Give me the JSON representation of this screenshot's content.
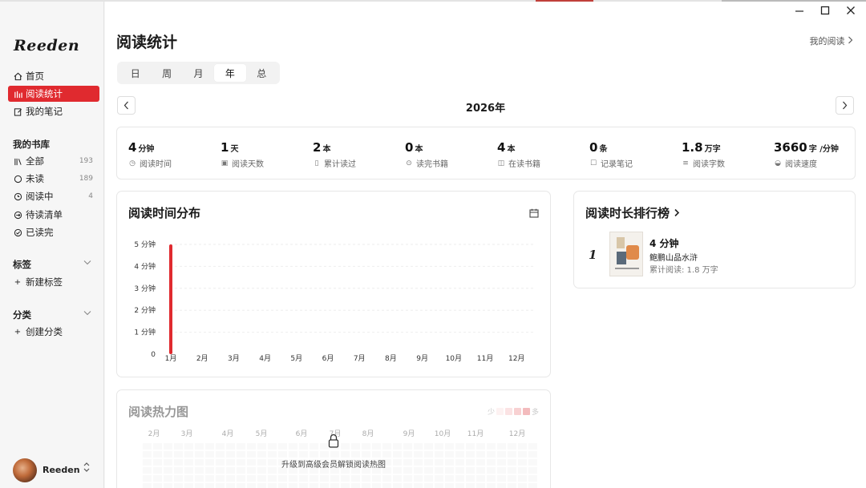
{
  "sidebar": {
    "logo": "Reeden",
    "nav": [
      {
        "label": "首页",
        "icon": "home-icon"
      },
      {
        "label": "阅读统计",
        "icon": "bar-chart-icon"
      },
      {
        "label": "我的笔记",
        "icon": "note-edit-icon"
      }
    ],
    "library_title": "我的书库",
    "library": [
      {
        "label": "全部",
        "count": "193",
        "icon": "bookshelf-icon"
      },
      {
        "label": "未读",
        "count": "189",
        "icon": "circle-icon"
      },
      {
        "label": "阅读中",
        "count": "4",
        "icon": "clock-icon"
      },
      {
        "label": "待读清单",
        "count": "",
        "icon": "arrow-circle-icon"
      },
      {
        "label": "已读完",
        "count": "",
        "icon": "check-circle-icon"
      }
    ],
    "tags_title": "标签",
    "new_tag": "新建标签",
    "category_title": "分类",
    "new_category": "创建分类",
    "user_name": "Reeden"
  },
  "header": {
    "title": "阅读统计",
    "my_reading": "我的阅读",
    "tabs": [
      "日",
      "周",
      "月",
      "年",
      "总"
    ],
    "active_tab": "年",
    "year": "2026年"
  },
  "stats": [
    {
      "value": "4",
      "unit": "分钟",
      "label": "阅读时间",
      "icon": "clock-icon"
    },
    {
      "value": "1",
      "unit": "天",
      "label": "阅读天数",
      "icon": "calendar-icon"
    },
    {
      "value": "2",
      "unit": "本",
      "label": "累计读过",
      "icon": "book-icon"
    },
    {
      "value": "0",
      "unit": "本",
      "label": "读完书籍",
      "icon": "check-circle-icon"
    },
    {
      "value": "4",
      "unit": "本",
      "label": "在读书籍",
      "icon": "open-book-icon"
    },
    {
      "value": "0",
      "unit": "条",
      "label": "记录笔记",
      "icon": "note-edit-icon"
    },
    {
      "value": "1.8",
      "unit": "万字",
      "label": "阅读字数",
      "icon": "lines-icon"
    },
    {
      "value": "3660",
      "unit": "字 /分钟",
      "label": "阅读速度",
      "icon": "speedometer-icon"
    }
  ],
  "time_dist": {
    "title": "阅读时间分布"
  },
  "chart_data": {
    "type": "bar",
    "categories": [
      "1月",
      "2月",
      "3月",
      "4月",
      "5月",
      "6月",
      "7月",
      "8月",
      "9月",
      "10月",
      "11月",
      "12月"
    ],
    "values": [
      5,
      0,
      0,
      0,
      0,
      0,
      0,
      0,
      0,
      0,
      0,
      0
    ],
    "y_tick_labels": [
      "0",
      "1 分钟",
      "2 分钟",
      "3 分钟",
      "4 分钟",
      "5 分钟"
    ],
    "ylim": [
      0,
      5
    ],
    "bar_color": "#e02a2f",
    "grid": true
  },
  "ranking": {
    "title": "阅读时长排行榜",
    "items": [
      {
        "rank": "1",
        "time": "4 分钟",
        "book": "鲍鹏山品水浒",
        "total": "累计阅读: 1.8 万字"
      }
    ]
  },
  "heatmap": {
    "title": "阅读热力图",
    "months": [
      "2月",
      "3月",
      "4月",
      "5月",
      "6月",
      "7月",
      "8月",
      "9月",
      "10月",
      "11月",
      "12月"
    ],
    "legend_low": "少",
    "legend_high": "多",
    "lock_message": "升级到高级会员解锁阅读热图"
  },
  "colors": {
    "accent": "#e02a2f"
  }
}
